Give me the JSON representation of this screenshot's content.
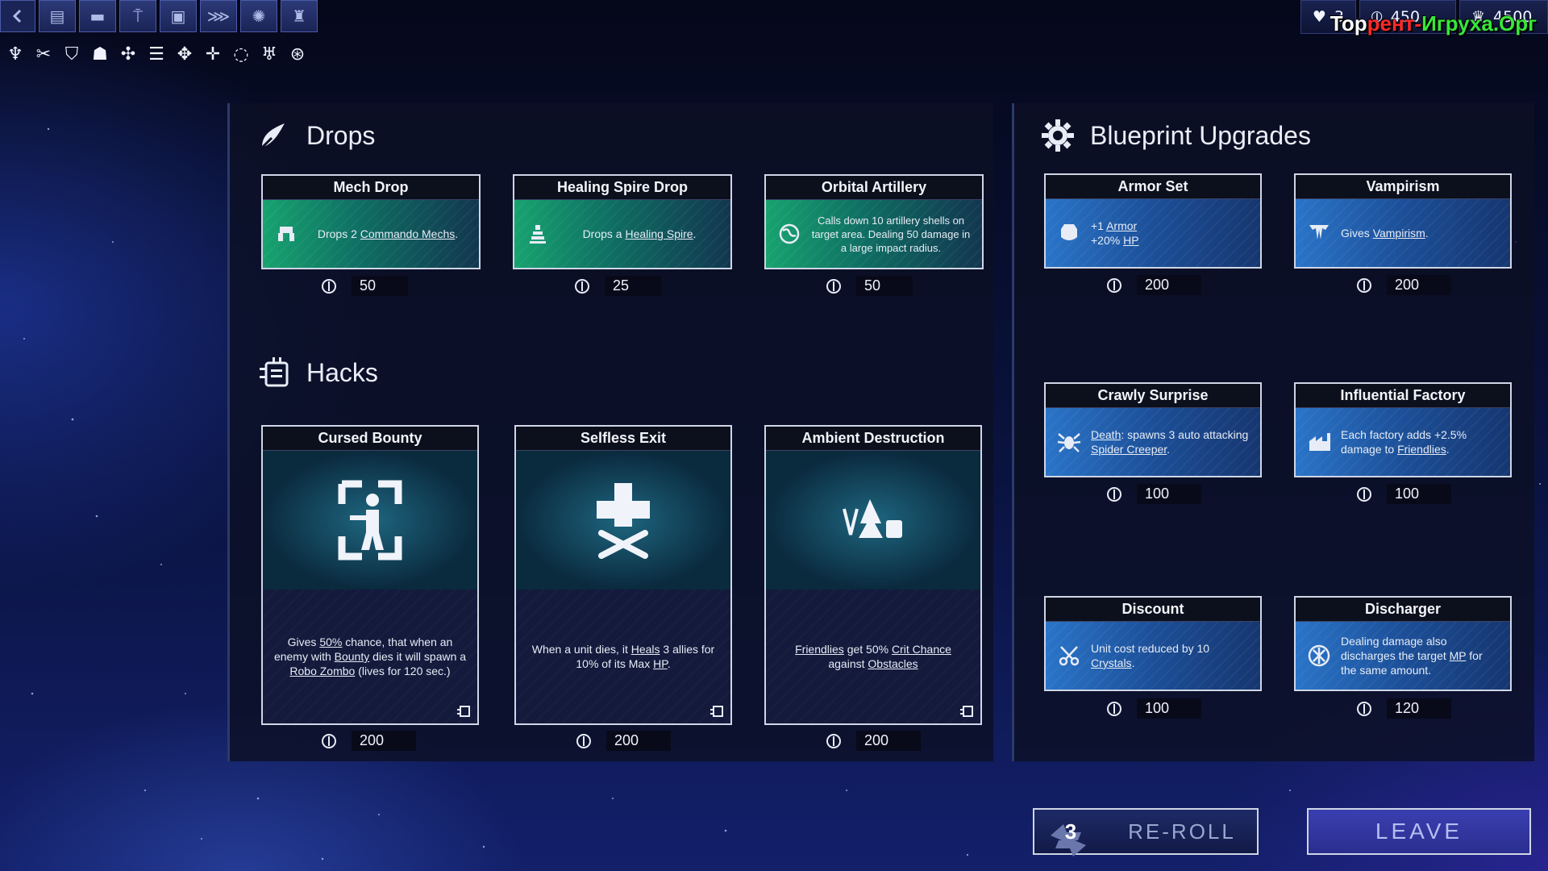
{
  "resources": {
    "lives": "3",
    "crystals": "450",
    "other": "4500",
    "watermark_1": "Тор",
    "watermark_2": "рент-",
    "watermark_3": "Игруха.Орг"
  },
  "drops": {
    "title": "Drops",
    "cards": [
      {
        "name": "Mech Drop",
        "desc_pre": "Drops 2 ",
        "kw": "Commando Mechs",
        "desc_post": ".",
        "price": "50",
        "icon": "mech-icon"
      },
      {
        "name": "Healing Spire Drop",
        "desc_pre": "Drops a ",
        "kw": "Healing Spire",
        "desc_post": ".",
        "price": "25",
        "icon": "spire-icon"
      },
      {
        "name": "Orbital Artillery",
        "desc_pre": "Calls down 10 artillery shells on target area. Dealing 50 damage in a large impact radius.",
        "kw": "",
        "desc_post": "",
        "price": "50",
        "icon": "globe-icon"
      }
    ]
  },
  "hacks": {
    "title": "Hacks",
    "cards": [
      {
        "name": "Cursed Bounty",
        "d1": "Gives ",
        "k1": "50%",
        "d2": " chance, that when an enemy with ",
        "k2": "Bounty",
        "d3": " dies it will spawn a ",
        "k3": "Robo Zombo",
        "d4": " (lives for 120 sec.)",
        "price": "200"
      },
      {
        "name": "Selfless Exit",
        "d1": "When a unit dies, it ",
        "k1": "Heals",
        "d2": " 3 allies for 10% of its Max ",
        "k2": "HP",
        "d3": ".",
        "k3": "",
        "d4": "",
        "price": "200"
      },
      {
        "name": "Ambient Destruction",
        "d1": "",
        "k1": "Friendlies",
        "d2": " get 50% ",
        "k2": "Crit Chance",
        "d3": " against ",
        "k3": "Obstacles",
        "d4": "",
        "price": "200"
      }
    ]
  },
  "blueprints": {
    "title": "Blueprint Upgrades",
    "cards": [
      {
        "name": "Armor Set",
        "l1a": "+1 ",
        "l1k": "Armor",
        "l2a": "+20% ",
        "l2k": "HP",
        "price": "200"
      },
      {
        "name": "Vampirism",
        "l1a": "Gives ",
        "l1k": "Vampirism",
        "l1b": ".",
        "price": "200"
      },
      {
        "name": "Crawly Surprise",
        "k1": "Death",
        "d1": ": spawns 3 auto attacking ",
        "k2": "Spider Creeper",
        "d2": ".",
        "price": "100"
      },
      {
        "name": "Influential Factory",
        "d1": "Each factory adds +2.5% damage to ",
        "k1": "Friendlies",
        "d2": ".",
        "price": "100"
      },
      {
        "name": "Discount",
        "d1": "Unit cost reduced by 10 ",
        "k1": "Crystals",
        "d2": ".",
        "price": "100"
      },
      {
        "name": "Discharger",
        "d1": "Dealing damage also discharges the target ",
        "k1": "MP",
        "d2": " for the same amount.",
        "price": "120"
      }
    ]
  },
  "buttons": {
    "reroll_count": "3",
    "reroll_label": "RE-ROLL",
    "leave_label": "LEAVE"
  }
}
